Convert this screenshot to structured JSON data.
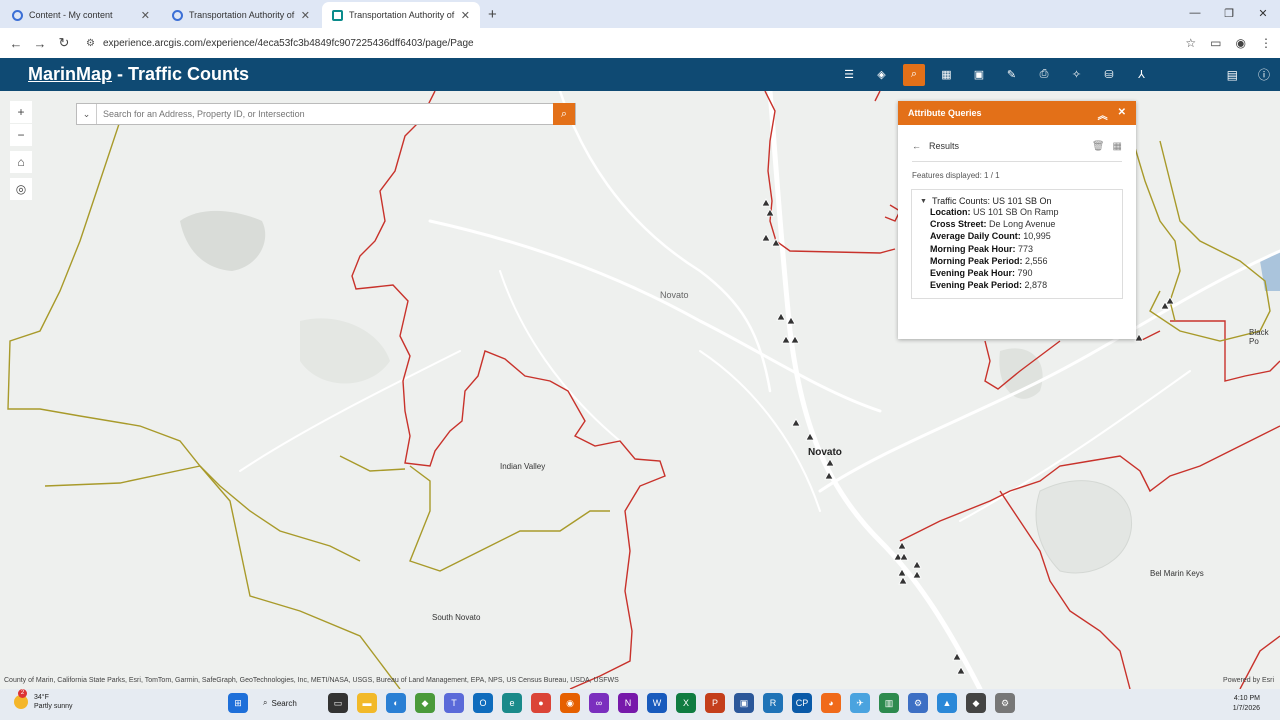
{
  "browser": {
    "tabs": [
      {
        "label": "Content - My content",
        "active": false
      },
      {
        "label": "Transportation Authority of Ma",
        "active": false
      },
      {
        "label": "Transportation Authority of Ma",
        "active": true
      }
    ],
    "new_tab": "+",
    "url": "experience.arcgis.com/experience/4eca53fc3b4849fc907225436dff6403/page/Page"
  },
  "app": {
    "title_link": "MarinMap",
    "title_rest": " - Traffic Counts"
  },
  "search": {
    "placeholder": "Search for an Address, Property ID, or Intersection"
  },
  "map": {
    "labels": {
      "novato_area": "Novato",
      "novato_city": "Novato",
      "indian_valley": "Indian Valley",
      "south_novato": "South Novato",
      "bel_marin_keys": "Bel Marin Keys",
      "black_point": "Black Po"
    },
    "attribution": "County of Marin, California State Parks, Esri, TomTom, Garmin, SafeGraph, GeoTechnologies, Inc, METI/NASA, USGS, Bureau of Land Management, EPA, NPS, US Census Bureau, USDA, USFWS",
    "powered_by": "Powered by Esri"
  },
  "panel": {
    "title": "Attribute Queries",
    "results_label": "Results",
    "features_displayed": "Features displayed: 1 / 1",
    "feature_title": "Traffic Counts: US 101 SB On",
    "fields": [
      {
        "label": "Location:",
        "value": "US 101 SB On Ramp"
      },
      {
        "label": "Cross Street:",
        "value": "De Long Avenue"
      },
      {
        "label": "Average Daily Count:",
        "value": "10,995"
      },
      {
        "label": "Morning Peak Hour:",
        "value": "773"
      },
      {
        "label": "Morning Peak Period:",
        "value": "2,556"
      },
      {
        "label": "Evening Peak Hour:",
        "value": "790"
      },
      {
        "label": "Evening Peak Period:",
        "value": "2,878"
      }
    ]
  },
  "taskbar": {
    "temperature": "34°F",
    "condition": "Partly sunny",
    "badge": "2",
    "search_label": "Search",
    "time": "4:10 PM",
    "date": "1/7/2026"
  },
  "colors": {
    "header": "#0f4a73",
    "accent": "#e37018",
    "boundary_red": "#c8322b",
    "boundary_olive": "#a89a2a"
  }
}
